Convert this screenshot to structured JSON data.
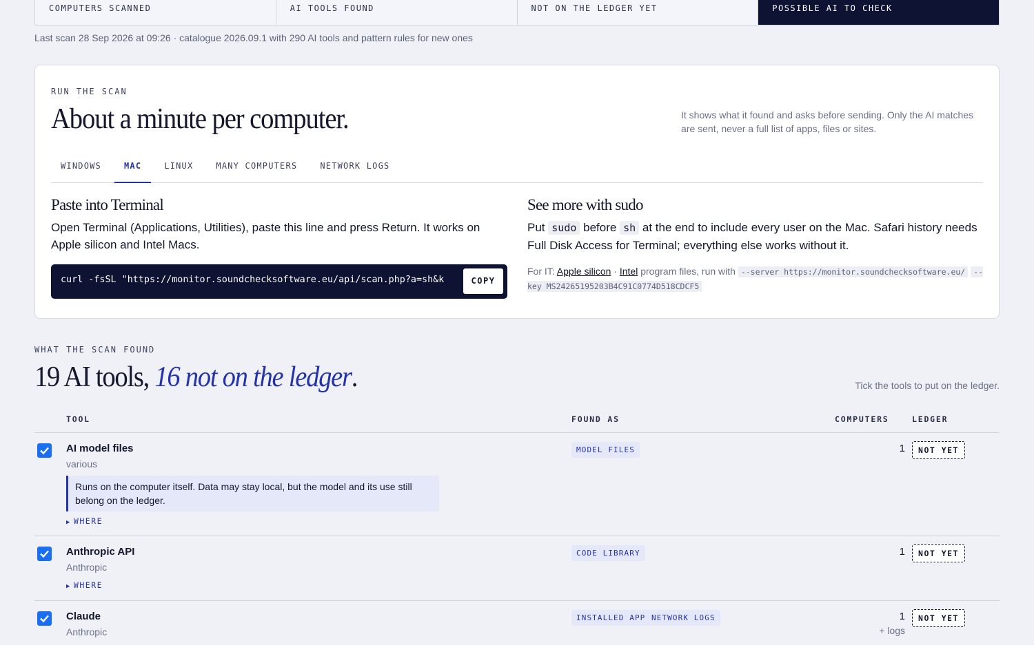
{
  "stats": {
    "computers_scanned": "COMPUTERS SCANNED",
    "ai_tools_found": "AI TOOLS FOUND",
    "not_on_ledger": "NOT ON THE LEDGER YET",
    "possible_ai": "POSSIBLE AI TO CHECK"
  },
  "scan_meta": "Last scan 28 Sep 2026 at 09:26 · catalogue 2026.09.1 with 290 AI tools and pattern rules for new ones",
  "run": {
    "eyebrow": "RUN THE SCAN",
    "title": "About a minute per computer.",
    "note": "It shows what it found and asks before sending. Only the AI matches are sent, never a full list of apps, files or sites.",
    "tabs": [
      "WINDOWS",
      "MAC",
      "LINUX",
      "MANY COMPUTERS",
      "NETWORK LOGS"
    ],
    "active_tab": "MAC",
    "paste": {
      "heading": "Paste into Terminal",
      "body": "Open Terminal (Applications, Utilities), paste this line and press Return. It works on Apple silicon and Intel Macs.",
      "command": "curl -fsSL \"https://monitor.soundchecksoftware.eu/api/scan.php?a=sh&k",
      "copy_label": "COPY"
    },
    "sudo": {
      "heading": "See more with sudo",
      "put": "Put",
      "sudo_code": "sudo",
      "before": "before",
      "sh_code": "sh",
      "rest": "at the end to include every user on the Mac. Safari history needs Full Disk Access for Terminal; everything else works without it."
    },
    "it": {
      "prefix": "For IT:",
      "apple_link": "Apple silicon",
      "sep": "·",
      "intel_link": "Intel",
      "middle": "program files, run with",
      "server_code": "--server https://monitor.soundchecksoftware.eu/",
      "key_code": "--key MS24265195203B4C91C0774D518CDCF5"
    }
  },
  "found": {
    "eyebrow": "WHAT THE SCAN FOUND",
    "title_plain": "19 AI tools, ",
    "title_em": "16 not on the ledger",
    "title_end": ".",
    "hint": "Tick the tools to put on the ledger.",
    "columns": {
      "tool": "TOOL",
      "found_as": "FOUND AS",
      "computers": "COMPUTERS",
      "ledger": "LEDGER"
    },
    "rows": [
      {
        "name": "AI model files",
        "vendor": "various",
        "checked": true,
        "callout": "Runs on the computer itself. Data may stay local, but the model and its use still belong on the ledger.",
        "where": "WHERE",
        "found_as": [
          "MODEL FILES"
        ],
        "computers": "1",
        "ledger": "NOT YET"
      },
      {
        "name": "Anthropic API",
        "vendor": "Anthropic",
        "checked": true,
        "where": "WHERE",
        "found_as": [
          "CODE LIBRARY"
        ],
        "computers": "1",
        "ledger": "NOT YET"
      },
      {
        "name": "Claude",
        "vendor": "Anthropic",
        "checked": true,
        "found_as": [
          "INSTALLED APP",
          "NETWORK LOGS"
        ],
        "computers": "1",
        "computers_note": "+ logs",
        "ledger": "NOT YET"
      }
    ]
  },
  "colors": {
    "accent": "#2434a8",
    "navy": "#0e1233",
    "checkbox": "#1a6ff0",
    "background": "#eff1f7"
  }
}
